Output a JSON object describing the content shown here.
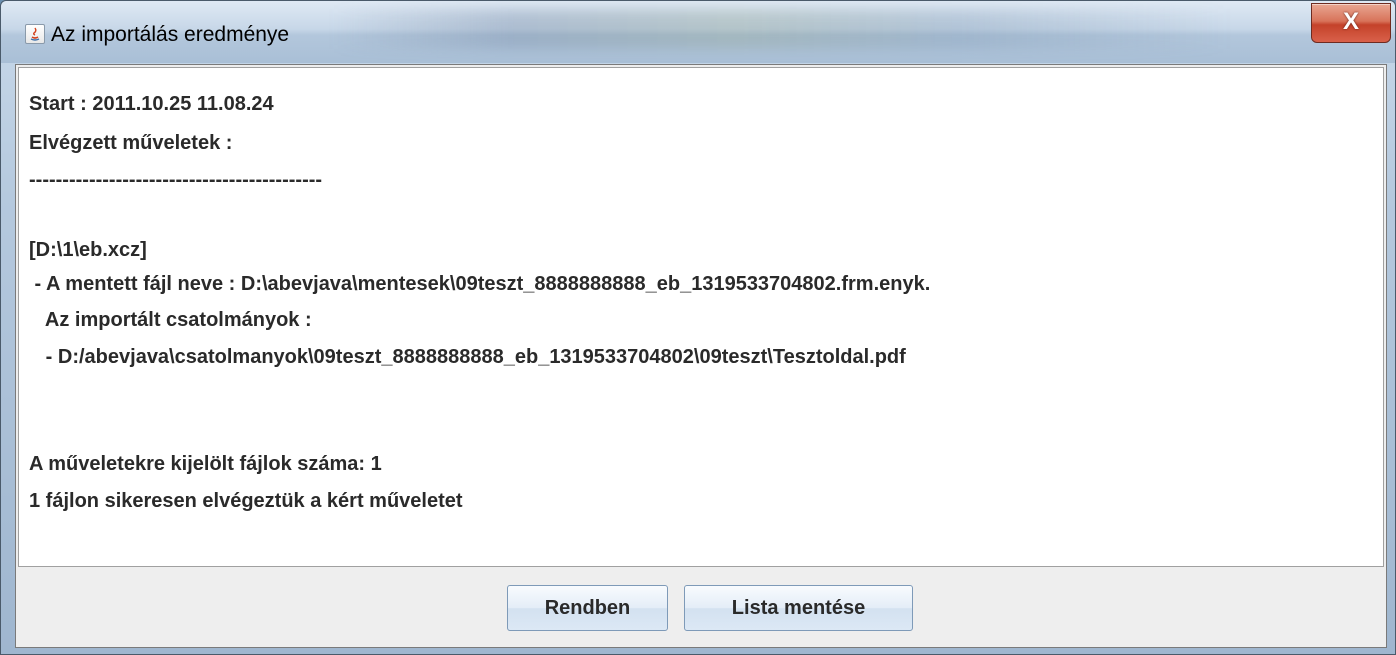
{
  "window": {
    "title": "Az importálás eredménye",
    "close_label": "X"
  },
  "log": {
    "lines": [
      "Start : 2011.10.25 11.08.24",
      "Elvégzett műveletek :",
      "--------------------------------------------",
      "",
      "[D:\\1\\eb.xcz]",
      " - A mentett fájl neve : D:\\abevjava\\mentesek\\09teszt_8888888888_eb_1319533704802.frm.enyk.",
      "   Az importált csatolmányok :",
      "   - D:/abevjava\\csatolmanyok\\09teszt_8888888888_eb_1319533704802\\09teszt\\Tesztoldal.pdf",
      "",
      "",
      "A műveletekre kijelölt fájlok száma: 1",
      "1 fájlon sikeresen elvégeztük a kért műveletet"
    ]
  },
  "buttons": {
    "ok_label": "Rendben",
    "save_list_label": "Lista mentése"
  }
}
